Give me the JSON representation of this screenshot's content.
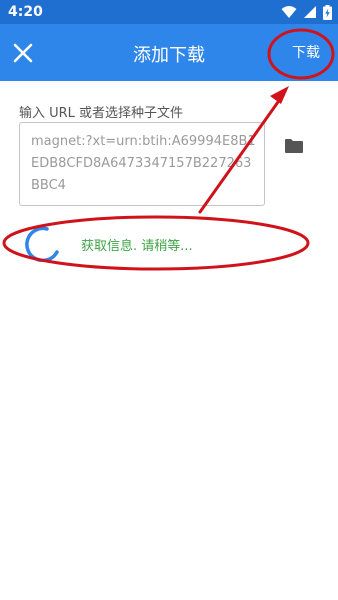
{
  "status_bar": {
    "time": "4:20",
    "icons": [
      "wifi-icon",
      "signal-icon",
      "battery-charging-icon"
    ]
  },
  "app_bar": {
    "title": "添加下载",
    "close_icon": "close-icon",
    "download_label": "下载"
  },
  "form": {
    "label": "输入 URL 或者选择种子文件",
    "url_value": "magnet:?xt=urn:btih:A69994E8B1EDB8CFD8A6473347157B227263BBC4",
    "folder_icon": "folder-icon"
  },
  "loading": {
    "text": "获取信息. 请稍等..."
  },
  "colors": {
    "status_bar": "#1e6fd0",
    "app_bar": "#2f86ea",
    "loading_text": "#3fa447",
    "annotation": "#d0121b"
  }
}
